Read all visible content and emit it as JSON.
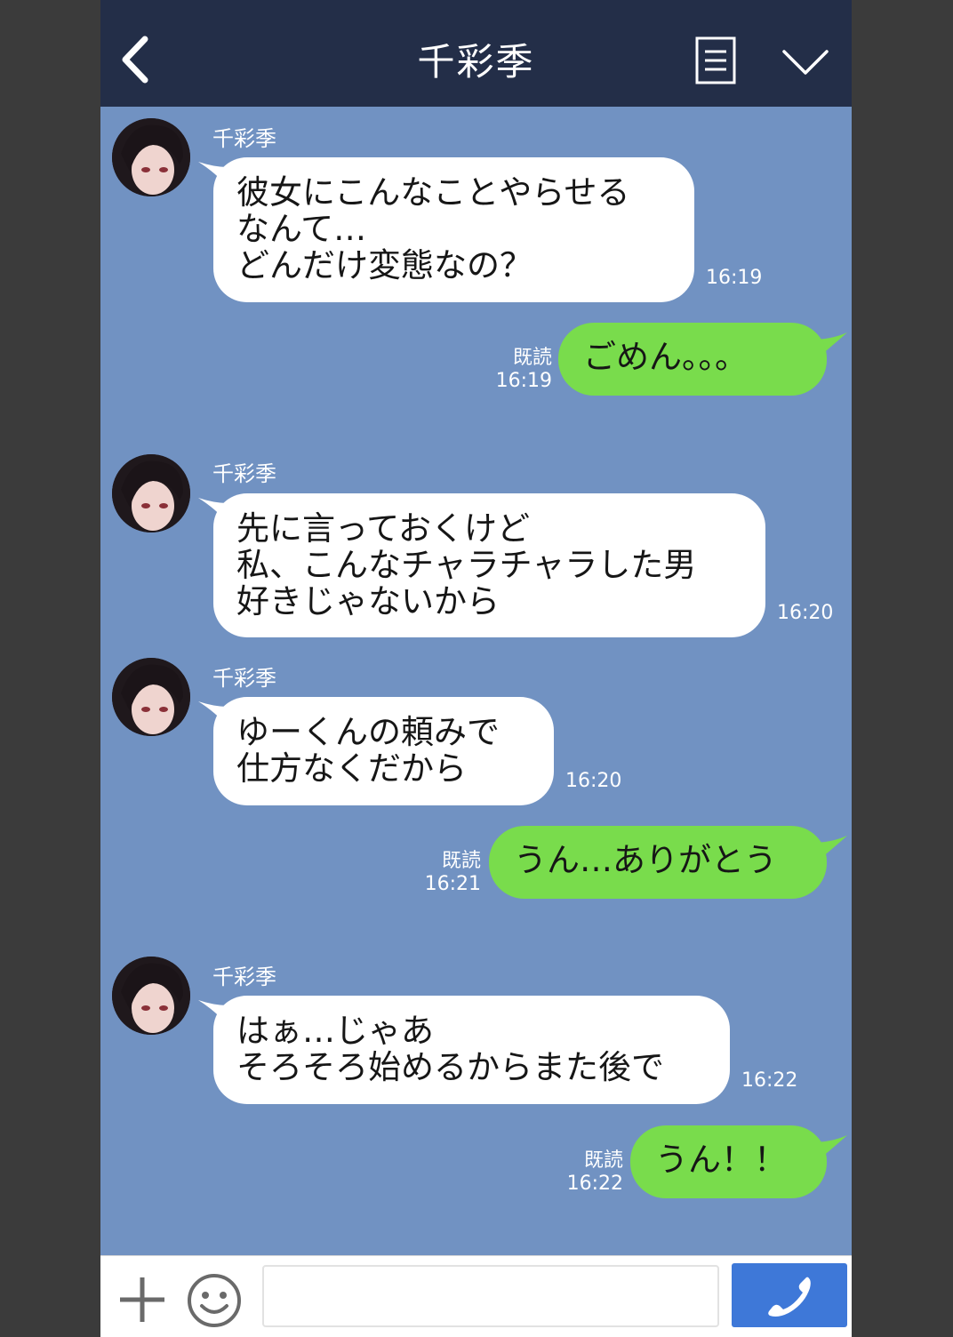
{
  "header": {
    "title": "千彩季",
    "back_icon": "chevron-left-icon",
    "menu_icon": "document-menu-icon",
    "dropdown_icon": "chevron-down-icon"
  },
  "messages": [
    {
      "direction": "in",
      "sender": "千彩季",
      "text": "彼女にこんなことやらせる\nなんて…\nどんだけ変態なの？",
      "time": "16:19"
    },
    {
      "direction": "out",
      "text": "ごめん。。。",
      "read": "既読",
      "time": "16:19"
    },
    {
      "direction": "in",
      "sender": "千彩季",
      "text": "先に言っておくけど\n私、こんなチャラチャラした男\n好きじゃないから",
      "time": "16:20"
    },
    {
      "direction": "in",
      "sender": "千彩季",
      "text": "ゆーくんの頼みで\n仕方なくだから",
      "time": "16:20"
    },
    {
      "direction": "out",
      "text": "うん…ありがとう",
      "read": "既読",
      "time": "16:21"
    },
    {
      "direction": "in",
      "sender": "千彩季",
      "text": "はぁ…じゃあ\nそろそろ始めるからまた後で",
      "time": "16:22"
    },
    {
      "direction": "out",
      "text": "うん！！",
      "read": "既読",
      "time": "16:22"
    }
  ],
  "input_bar": {
    "plus_icon": "plus-icon",
    "emoji_icon": "smiley-icon",
    "message_placeholder": "",
    "send_icon": "phone-call-icon"
  },
  "colors": {
    "header_bg": "#232e48",
    "chat_bg": "#7192c2",
    "outgoing_bubble": "#79dc4c",
    "incoming_bubble": "#ffffff",
    "send_button": "#3e78d8"
  }
}
